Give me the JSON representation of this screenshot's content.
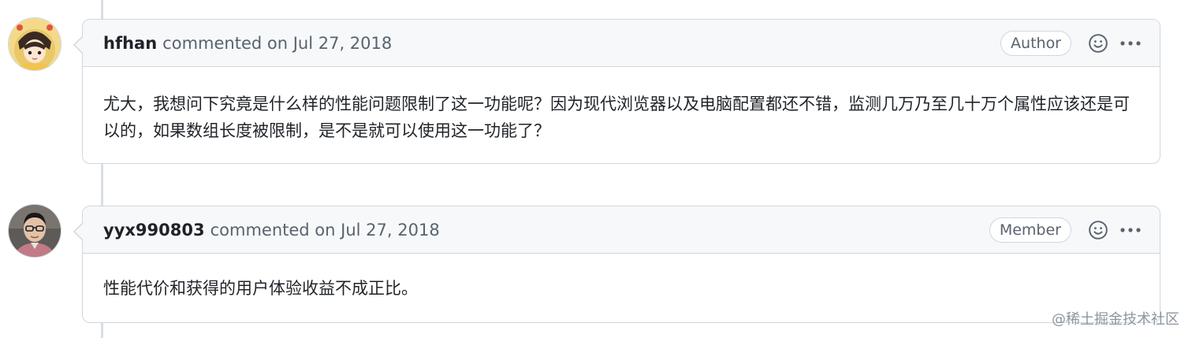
{
  "comments": [
    {
      "author": "hfhan",
      "action": "commented on",
      "date": "Jul 27, 2018",
      "badge": "Author",
      "avatar_icon": "anime-avatar-icon",
      "body": "尤大，我想问下究竟是什么样的性能问题限制了这一功能呢？因为现代浏览器以及电脑配置都还不错，监测几万乃至几十万个属性应该还是可以的，如果数组长度被限制，是不是就可以使用这一功能了？"
    },
    {
      "author": "yyx990803",
      "action": "commented on",
      "date": "Jul 27, 2018",
      "badge": "Member",
      "avatar_icon": "person-avatar-icon",
      "body": "性能代价和获得的用户体验收益不成正比。"
    }
  ],
  "watermark": "@稀土掘金技术社区",
  "colors": {
    "border": "#d0d7de",
    "header_bg": "#f6f8fa",
    "text": "#1f2328",
    "muted": "#59636e"
  },
  "icons": {
    "reaction": "smiley-icon",
    "menu": "kebab-horizontal-icon"
  }
}
